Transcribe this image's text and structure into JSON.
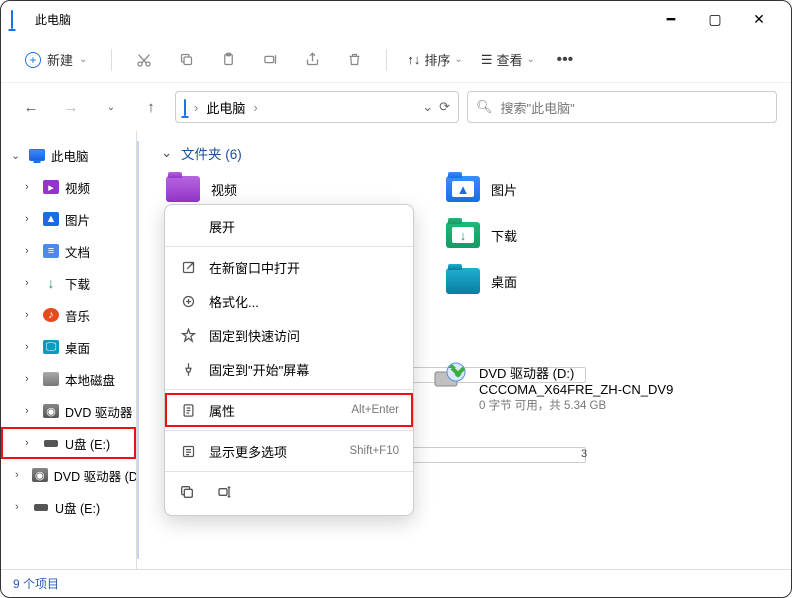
{
  "title": "此电脑",
  "toolbar": {
    "new": "新建",
    "sort": "排序",
    "view": "查看"
  },
  "nav": {
    "breadcrumb0": "此电脑",
    "search_placeholder": "搜索\"此电脑\""
  },
  "sidebar": {
    "root": "此电脑",
    "items": [
      {
        "label": "视频"
      },
      {
        "label": "图片"
      },
      {
        "label": "文档"
      },
      {
        "label": "下载"
      },
      {
        "label": "音乐"
      },
      {
        "label": "桌面"
      },
      {
        "label": "本地磁盘"
      },
      {
        "label": "DVD 驱动器"
      },
      {
        "label": "U盘 (E:)"
      },
      {
        "label": "DVD 驱动器 (D:)"
      },
      {
        "label": "U盘 (E:)"
      }
    ]
  },
  "section": {
    "folders_header": "文件夹 (6)",
    "items": [
      {
        "label": "视频"
      },
      {
        "label": "图片"
      },
      {
        "label": "下载"
      },
      {
        "label": "桌面"
      }
    ]
  },
  "drive": {
    "name": "DVD 驱动器 (D:)",
    "sub1": "CCCOMA_X64FRE_ZH-CN_DV9",
    "sub2": "0 字节 可用，共 5.34 GB"
  },
  "context_menu": {
    "expand": "展开",
    "open_new_window": "在新窗口中打开",
    "format": "格式化...",
    "pin_quick": "固定到快速访问",
    "pin_start": "固定到\"开始\"屏幕",
    "properties": "属性",
    "properties_kbd": "Alt+Enter",
    "more_options": "显示更多选项",
    "more_options_kbd": "Shift+F10"
  },
  "status": "9 个项目",
  "storage_letter": "3"
}
